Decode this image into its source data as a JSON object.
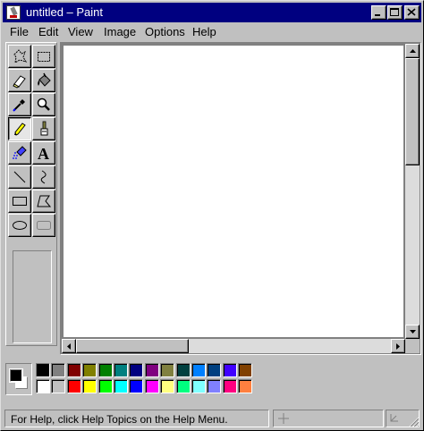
{
  "window": {
    "title": "untitled – Paint",
    "title_bar_color": "#000080"
  },
  "title_buttons": [
    "minimize",
    "maximize",
    "close"
  ],
  "menu": {
    "items": [
      "File",
      "Edit",
      "View",
      "Image",
      "Options",
      "Help"
    ]
  },
  "toolbox": {
    "tools": [
      {
        "name": "free-form-select",
        "icon": "free-form-select-icon",
        "selected": false
      },
      {
        "name": "rectangle-select",
        "icon": "rectangle-select-icon",
        "selected": false
      },
      {
        "name": "eraser",
        "icon": "eraser-icon",
        "selected": false
      },
      {
        "name": "fill-with-color",
        "icon": "paint-bucket-icon",
        "selected": false
      },
      {
        "name": "pick-color",
        "icon": "eyedropper-icon",
        "selected": false
      },
      {
        "name": "magnifier",
        "icon": "magnifier-icon",
        "selected": false
      },
      {
        "name": "pencil",
        "icon": "pencil-icon",
        "selected": true
      },
      {
        "name": "brush",
        "icon": "brush-icon",
        "selected": false
      },
      {
        "name": "airbrush",
        "icon": "airbrush-icon",
        "selected": false
      },
      {
        "name": "text",
        "icon": "text-icon",
        "selected": false
      },
      {
        "name": "line",
        "icon": "line-icon",
        "selected": false
      },
      {
        "name": "curve",
        "icon": "curve-icon",
        "selected": false
      },
      {
        "name": "rectangle",
        "icon": "rectangle-icon",
        "selected": false
      },
      {
        "name": "polygon",
        "icon": "polygon-icon",
        "selected": false
      },
      {
        "name": "ellipse",
        "icon": "ellipse-icon",
        "selected": false
      },
      {
        "name": "rounded-rectangle",
        "icon": "rounded-rectangle-icon",
        "selected": false
      }
    ],
    "text_tool_glyph": "A"
  },
  "colors": {
    "foreground": "#000000",
    "background": "#ffffff",
    "palette_row1": [
      "#000000",
      "#808080",
      "#800000",
      "#808000",
      "#008000",
      "#008080",
      "#000080",
      "#800080",
      "#808040",
      "#004040",
      "#0080ff",
      "#004080",
      "#4000ff",
      "#804000"
    ],
    "palette_row2": [
      "#ffffff",
      "#c0c0c0",
      "#ff0000",
      "#ffff00",
      "#00ff00",
      "#00ffff",
      "#0000ff",
      "#ff00ff",
      "#ffff80",
      "#00ff80",
      "#80ffff",
      "#8080ff",
      "#ff0080",
      "#ff8040"
    ]
  },
  "status": {
    "help_text": "For Help, click Help Topics on the Help Menu."
  }
}
